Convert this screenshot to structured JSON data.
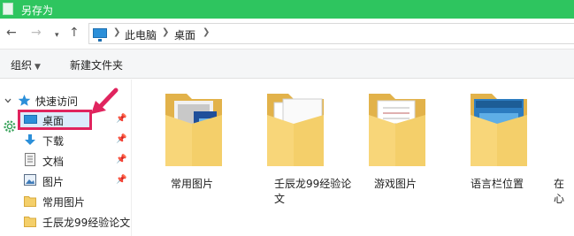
{
  "window": {
    "title": "另存为"
  },
  "address": {
    "crumbs": [
      "此电脑",
      "桌面"
    ]
  },
  "toolbar": {
    "organize": "组织",
    "new_folder": "新建文件夹"
  },
  "sidebar": {
    "quick_access": "快速访问",
    "items": [
      {
        "label": "桌面",
        "icon": "desktop-icon",
        "pinned": true,
        "selected": true
      },
      {
        "label": "下载",
        "icon": "download-icon",
        "pinned": true
      },
      {
        "label": "文档",
        "icon": "document-icon",
        "pinned": true
      },
      {
        "label": "图片",
        "icon": "picture-icon",
        "pinned": true
      },
      {
        "label": "常用图片",
        "icon": "folder-icon",
        "pinned": false
      },
      {
        "label": "壬辰龙99经验论文",
        "icon": "folder-icon",
        "pinned": false
      }
    ]
  },
  "content": {
    "folders": [
      {
        "line1": "常用图片",
        "line2": ""
      },
      {
        "line1": "壬辰龙99经验论",
        "line2": "文"
      },
      {
        "line1": "游戏图片",
        "line2": ""
      },
      {
        "line1": "语言栏位置",
        "line2": ""
      },
      {
        "line1": "在",
        "line2": "心"
      }
    ]
  },
  "colors": {
    "titlebar": "#2ec55f",
    "highlight": "#e0245e",
    "accent": "#2b8fd9",
    "folder": "#f4cf6a"
  }
}
